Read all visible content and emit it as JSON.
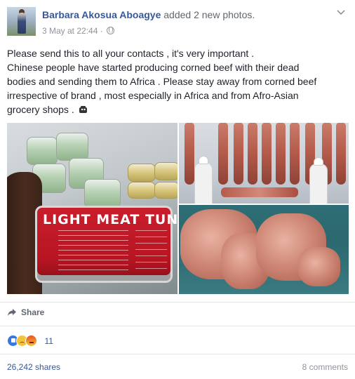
{
  "post": {
    "author": "Barbara Akosua Aboagye",
    "action": "added 2 new photos.",
    "timestamp": "3 May at 22:44",
    "separator": "·",
    "privacy_icon": "globe-icon",
    "menu_icon": "chevron-down-icon",
    "text_lines": [
      "Please send this to all your contacts , it's very important .",
      "Chinese people have started producing corned beef with their dead",
      "bodies and sending them to Africa . Please stay away from corned beef",
      "irrespective of brand , most especially in Africa and from Afro-Asian",
      "grocery shops ."
    ],
    "text_emoji_icon": "ghost-emoji-icon",
    "photos": {
      "left": {
        "label": "LIGHT MEAT TUNA"
      }
    }
  },
  "actions": {
    "share_label": "Share",
    "share_icon": "share-arrow-icon"
  },
  "reactions": {
    "icons": [
      "like-reaction-icon",
      "sad-reaction-icon",
      "angry-reaction-icon"
    ],
    "count": "11"
  },
  "stats": {
    "shares": "26,242 shares",
    "comments": "8 comments"
  },
  "colors": {
    "link": "#365899",
    "text": "#1d2129",
    "meta": "#90949c",
    "like_blue": "#3578e5"
  }
}
